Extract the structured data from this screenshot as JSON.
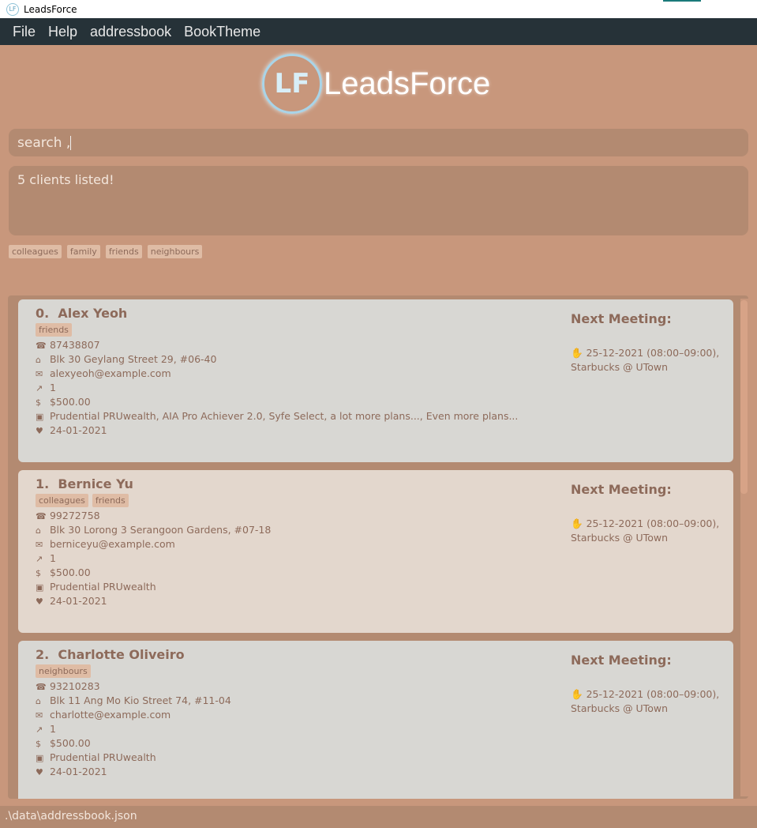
{
  "window": {
    "title": "LeadsForce"
  },
  "menu": [
    "File",
    "Help",
    "addressbook",
    "BookTheme"
  ],
  "logo": {
    "mark": "LF",
    "text": "LeadsForce"
  },
  "search": {
    "value": "search ,"
  },
  "result": {
    "text": "5 clients listed!"
  },
  "tags": [
    "colleagues",
    "family",
    "friends",
    "neighbours"
  ],
  "next_meeting_label": "Next Meeting:",
  "clients": [
    {
      "index": "0.",
      "name": "Alex Yeoh",
      "tags": [
        "friends"
      ],
      "phone": "87438807",
      "address": "Blk 30 Geylang Street 29, #06-40",
      "email": "alexyeoh@example.com",
      "risk": "1",
      "income": "$500.00",
      "plans": "Prudential PRUwealth, AIA Pro Achiever 2.0, Syfe Select, a lot more plans..., Even more plans...",
      "last_met": "24-01-2021",
      "meeting": "25-12-2021 (08:00–09:00),",
      "meeting_place": "Starbucks @ UTown",
      "bg": "#d8d7d3"
    },
    {
      "index": "1.",
      "name": "Bernice Yu",
      "tags": [
        "colleagues",
        "friends"
      ],
      "phone": "99272758",
      "address": "Blk 30 Lorong 3 Serangoon Gardens, #07-18",
      "email": "berniceyu@example.com",
      "risk": "1",
      "income": "$500.00",
      "plans": "Prudential PRUwealth",
      "last_met": "24-01-2021",
      "meeting": "25-12-2021 (08:00–09:00),",
      "meeting_place": "Starbucks @ UTown",
      "bg": "#e3d7cd"
    },
    {
      "index": "2.",
      "name": "Charlotte Oliveiro",
      "tags": [
        "neighbours"
      ],
      "phone": "93210283",
      "address": "Blk 11 Ang Mo Kio Street 74, #11-04",
      "email": "charlotte@example.com",
      "risk": "1",
      "income": "$500.00",
      "plans": "Prudential PRUwealth",
      "last_met": "24-01-2021",
      "meeting": "25-12-2021 (08:00–09:00),",
      "meeting_place": "Starbucks @ UTown",
      "bg": "#d8d7d3"
    }
  ],
  "status": {
    "path": ".\\data\\addressbook.json"
  }
}
